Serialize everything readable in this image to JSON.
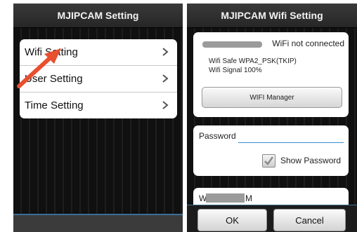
{
  "left_screen": {
    "title": "MJIPCAM  Setting",
    "menu_items": [
      {
        "label": "Wifi Setting"
      },
      {
        "label": "User Setting"
      },
      {
        "label": "Time Setting"
      }
    ]
  },
  "right_screen": {
    "title": "MJIPCAM  Wifi Setting",
    "wifi_status": "WiFi not connected",
    "wifi_safe": "Wifi Safe   WPA2_PSK(TKIP)",
    "wifi_signal": "Wifi Signal   100%",
    "wifi_manager_button": "WIFI Manager",
    "password_label": "Password",
    "password_value": "",
    "show_password_label": "Show Password",
    "show_password_checked": true,
    "field3_prefix": "W",
    "field3_suffix": "M",
    "ok_button": "OK",
    "cancel_button": "Cancel"
  },
  "annotation": {
    "icon": "red-arrow-icon",
    "color": "#e8502f"
  }
}
